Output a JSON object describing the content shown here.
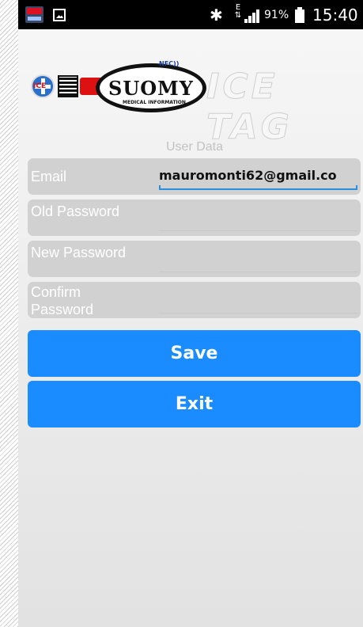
{
  "status_bar": {
    "battery_percent": "91%",
    "time": "15:40",
    "network_label": "E",
    "icons": [
      "app-notification-icon",
      "image-icon",
      "bluetooth-icon",
      "signal-icon",
      "battery-icon"
    ]
  },
  "logo": {
    "ice_badge": "ICE",
    "brand": "SUOMY",
    "brand_sub": "MEDICAL INFORMATION",
    "nfc": "NFC",
    "product": "ICE TAG"
  },
  "form": {
    "title": "User Data",
    "email": {
      "label": "Email",
      "value": "mauromonti62@gmail.co"
    },
    "old_password": {
      "label": "Old Password",
      "value": ""
    },
    "new_password": {
      "label": "New Password",
      "value": ""
    },
    "confirm_password": {
      "label_line1": "Confirm",
      "label_line2": "Password",
      "value": ""
    }
  },
  "buttons": {
    "save": "Save",
    "exit": "Exit"
  },
  "colors": {
    "accent": "#1a8cff",
    "field_bg": "#d1d1d1",
    "focus_underline": "#2b8fe0"
  }
}
